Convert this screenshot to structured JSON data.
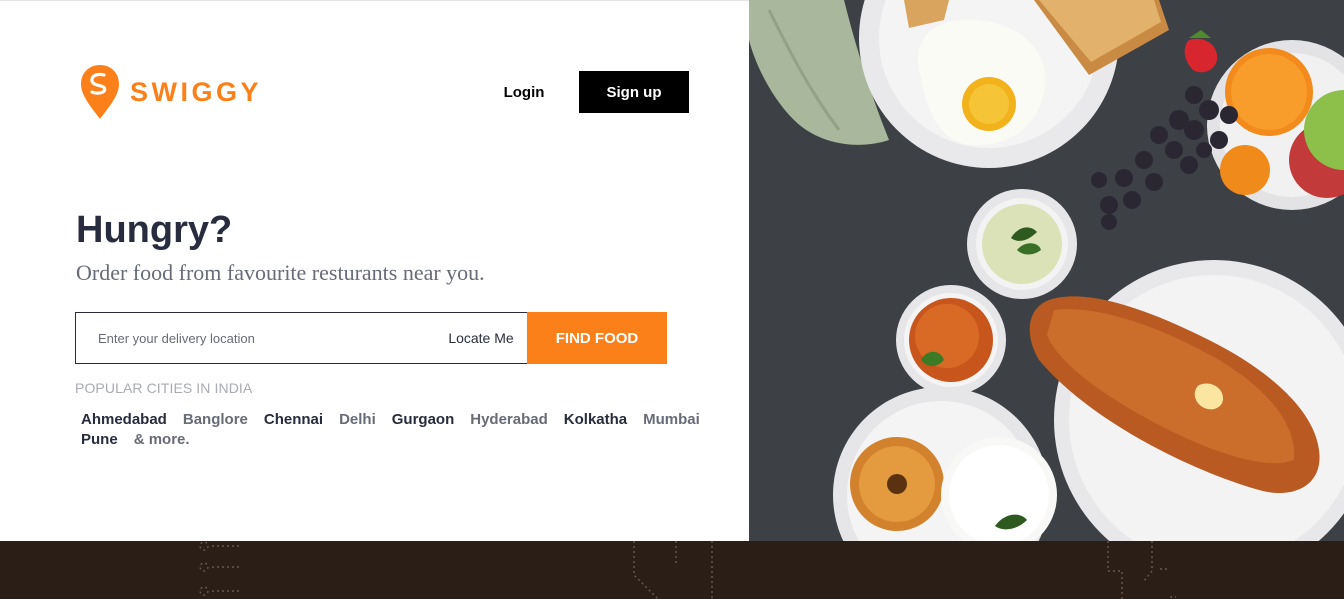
{
  "brand": {
    "name": "SWIGGY",
    "color": "#fc8019"
  },
  "header": {
    "login_label": "Login",
    "signup_label": "Sign up"
  },
  "hero": {
    "title": "Hungry?",
    "subtitle": "Order food from favourite resturants near you."
  },
  "search": {
    "placeholder": "Enter your delivery location",
    "value": "",
    "locate_label": "Locate Me",
    "find_label": "FIND FOOD"
  },
  "popular": {
    "heading": "POPULAR CITIES IN INDIA",
    "cities": [
      "Ahmedabad",
      "Banglore",
      "Chennai",
      "Delhi",
      "Gurgaon",
      "Hyderabad",
      "Kolkatha",
      "Mumbai",
      "Pune",
      "& more."
    ]
  }
}
